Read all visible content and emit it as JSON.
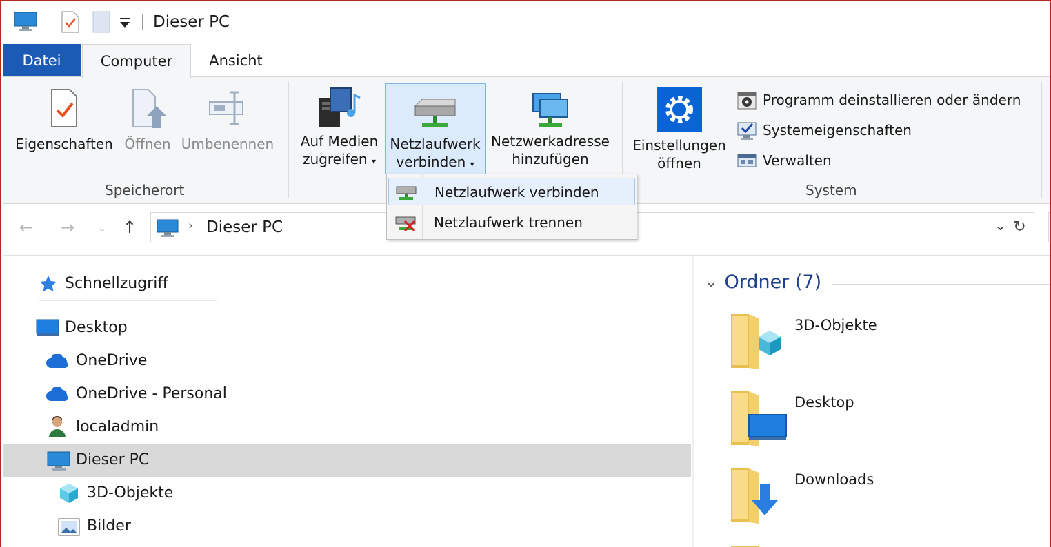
{
  "window": {
    "title": "Dieser PC"
  },
  "tabs": {
    "file": "Datei",
    "computer": "Computer",
    "view": "Ansicht"
  },
  "ribbon": {
    "location": {
      "label": "Speicherort",
      "properties": "Eigenschaften",
      "open": "Öffnen",
      "rename": "Umbenennen"
    },
    "network": {
      "media_line1": "Auf Medien",
      "media_line2": "zugreifen",
      "map_line1": "Netzlaufwerk",
      "map_line2": "verbinden",
      "addloc_line1": "Netzwerkadresse",
      "addloc_line2": "hinzufügen"
    },
    "system": {
      "label": "System",
      "settings_line1": "Einstellungen",
      "settings_line2": "öffnen",
      "uninstall": "Programm deinstallieren oder ändern",
      "sysprops": "Systemeigenschaften",
      "manage": "Verwalten"
    }
  },
  "dropdown": {
    "items": [
      {
        "label": "Netzlaufwerk verbinden"
      },
      {
        "label": "Netzlaufwerk trennen"
      }
    ]
  },
  "address": {
    "path": "Dieser PC"
  },
  "navpane": {
    "items": [
      {
        "label": "Schnellzugriff"
      },
      {
        "label": "Desktop"
      },
      {
        "label": "OneDrive"
      },
      {
        "label": "OneDrive - Personal"
      },
      {
        "label": "localadmin"
      },
      {
        "label": "Dieser PC"
      },
      {
        "label": "3D-Objekte"
      },
      {
        "label": "Bilder"
      }
    ]
  },
  "content": {
    "group_title": "Ordner (7)",
    "folders": [
      {
        "name": "3D-Objekte"
      },
      {
        "name": "Desktop"
      },
      {
        "name": "Downloads"
      }
    ]
  },
  "colors": {
    "accent": "#1c5bb5",
    "selection": "#d9d9d9",
    "hover": "#dcebfc",
    "group_header": "#1e3f8a"
  }
}
